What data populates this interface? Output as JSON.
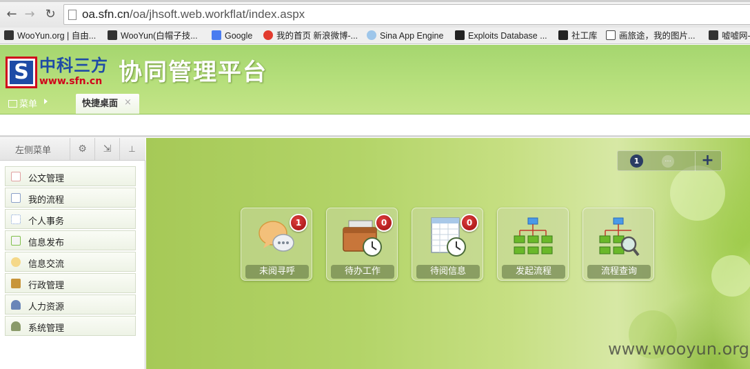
{
  "browser": {
    "url_host": "oa.sfn.cn",
    "url_path": "/oa/jhsoft.web.workflat/index.aspx",
    "bookmarks": [
      {
        "label": "WooYun.org | 自由...",
        "icon": "wooyun-icon",
        "color": "#333333"
      },
      {
        "label": "WooYun(白帽子技...",
        "icon": "wooyun-icon",
        "color": "#333333"
      },
      {
        "label": "Google",
        "icon": "google-icon",
        "color": "#4a7cf0"
      },
      {
        "label": "我的首页 新浪微博-...",
        "icon": "weibo-icon",
        "color": "#e23b2e"
      },
      {
        "label": "Sina App Engine",
        "icon": "cloud-icon",
        "color": "#9ec6ea"
      },
      {
        "label": "Exploits Database ...",
        "icon": "exploit-db-icon",
        "color": "#222222"
      },
      {
        "label": "社工库",
        "icon": "shegongku-icon",
        "color": "#222222"
      },
      {
        "label": "画旅途，我的图片...",
        "icon": "photo-icon",
        "color": "#444444"
      },
      {
        "label": "嘘嘘网-",
        "icon": "runner-icon",
        "color": "#333333"
      }
    ]
  },
  "header": {
    "logo_letter": "S",
    "logo_cn": "中科三方",
    "logo_url": "www.sfn.cn",
    "title": "协同管理平台",
    "menu_label": "菜单",
    "active_tab": "快捷桌面",
    "tab_close": "×"
  },
  "sidebar": {
    "title": "左侧菜单",
    "tools": [
      {
        "name": "settings-icon",
        "glyph": "⚙"
      },
      {
        "name": "export-icon",
        "glyph": "⇲"
      },
      {
        "name": "pin-icon",
        "glyph": "📌"
      }
    ],
    "items": [
      {
        "label": "公文管理",
        "icon": "document-icon",
        "color": "#e0a0a0"
      },
      {
        "label": "我的流程",
        "icon": "flow-icon",
        "color": "#8aa0c8"
      },
      {
        "label": "个人事务",
        "icon": "calendar-icon",
        "color": "#7fa0d0"
      },
      {
        "label": "信息发布",
        "icon": "publish-icon",
        "color": "#7fbf4a"
      },
      {
        "label": "信息交流",
        "icon": "chat-icon",
        "color": "#e5b84a"
      },
      {
        "label": "行政管理",
        "icon": "admin-icon",
        "color": "#c8953a"
      },
      {
        "label": "人力资源",
        "icon": "people-icon",
        "color": "#6a86b8"
      },
      {
        "label": "系统管理",
        "icon": "system-user-icon",
        "color": "#8a9a6a"
      }
    ]
  },
  "pager": {
    "current": "1",
    "more": "...",
    "add": "+"
  },
  "tiles": [
    {
      "label": "未阅寻呼",
      "badge": "1",
      "icon": "message-bubbles-icon"
    },
    {
      "label": "待办工作",
      "badge": "0",
      "icon": "briefcase-clock-icon"
    },
    {
      "label": "待阅信息",
      "badge": "0",
      "icon": "spreadsheet-clock-icon"
    },
    {
      "label": "发起流程",
      "badge": null,
      "icon": "org-chart-icon"
    },
    {
      "label": "流程查询",
      "badge": null,
      "icon": "org-chart-search-icon"
    }
  ],
  "watermark": "www.wooyun.org"
}
